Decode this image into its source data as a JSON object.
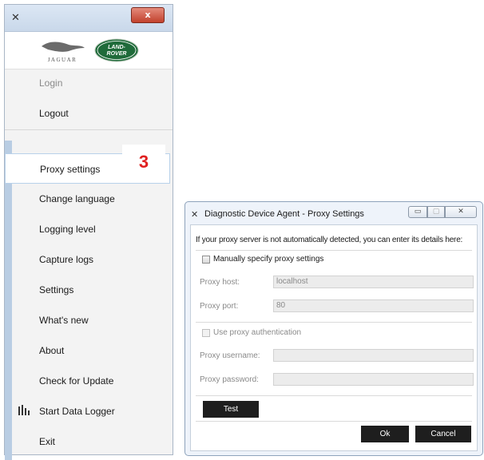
{
  "menu_window": {
    "brand": {
      "jaguar": "JAGUAR",
      "landrover_line1": "LAND-",
      "landrover_line2": "ROVER"
    },
    "items": [
      {
        "label": "Login",
        "enabled": false
      },
      {
        "label": "Logout",
        "enabled": true
      },
      {
        "label": "Proxy settings",
        "enabled": true,
        "highlighted": true
      },
      {
        "label": "Change language",
        "enabled": true
      },
      {
        "label": "Logging level",
        "enabled": true
      },
      {
        "label": "Capture logs",
        "enabled": true
      },
      {
        "label": "Settings",
        "enabled": true
      },
      {
        "label": "What's new",
        "enabled": true
      },
      {
        "label": "About",
        "enabled": true
      },
      {
        "label": "Check for Update",
        "enabled": true
      },
      {
        "label": "Start Data Logger",
        "enabled": true,
        "icon": "bar-chart-icon"
      },
      {
        "label": "Exit",
        "enabled": true
      }
    ],
    "close_glyph": "x"
  },
  "step_badge": "3",
  "dialog": {
    "title": "Diagnostic Device Agent - Proxy Settings",
    "intro": "If your proxy server is not automatically detected, you can enter its details here:",
    "manual_label": "Manually specify proxy settings",
    "manual_checked": false,
    "proxy_host_label": "Proxy host:",
    "proxy_host_value": "localhost",
    "proxy_port_label": "Proxy port:",
    "proxy_port_value": "80",
    "use_auth_label": "Use proxy authentication",
    "use_auth_checked": false,
    "proxy_username_label": "Proxy username:",
    "proxy_username_value": "",
    "proxy_password_label": "Proxy password:",
    "proxy_password_value": "",
    "test_label": "Test",
    "ok_label": "Ok",
    "cancel_label": "Cancel"
  },
  "colors": {
    "badge": "#e02020",
    "accent": "#b8d1ea",
    "button_dark": "#1e1e1e"
  }
}
